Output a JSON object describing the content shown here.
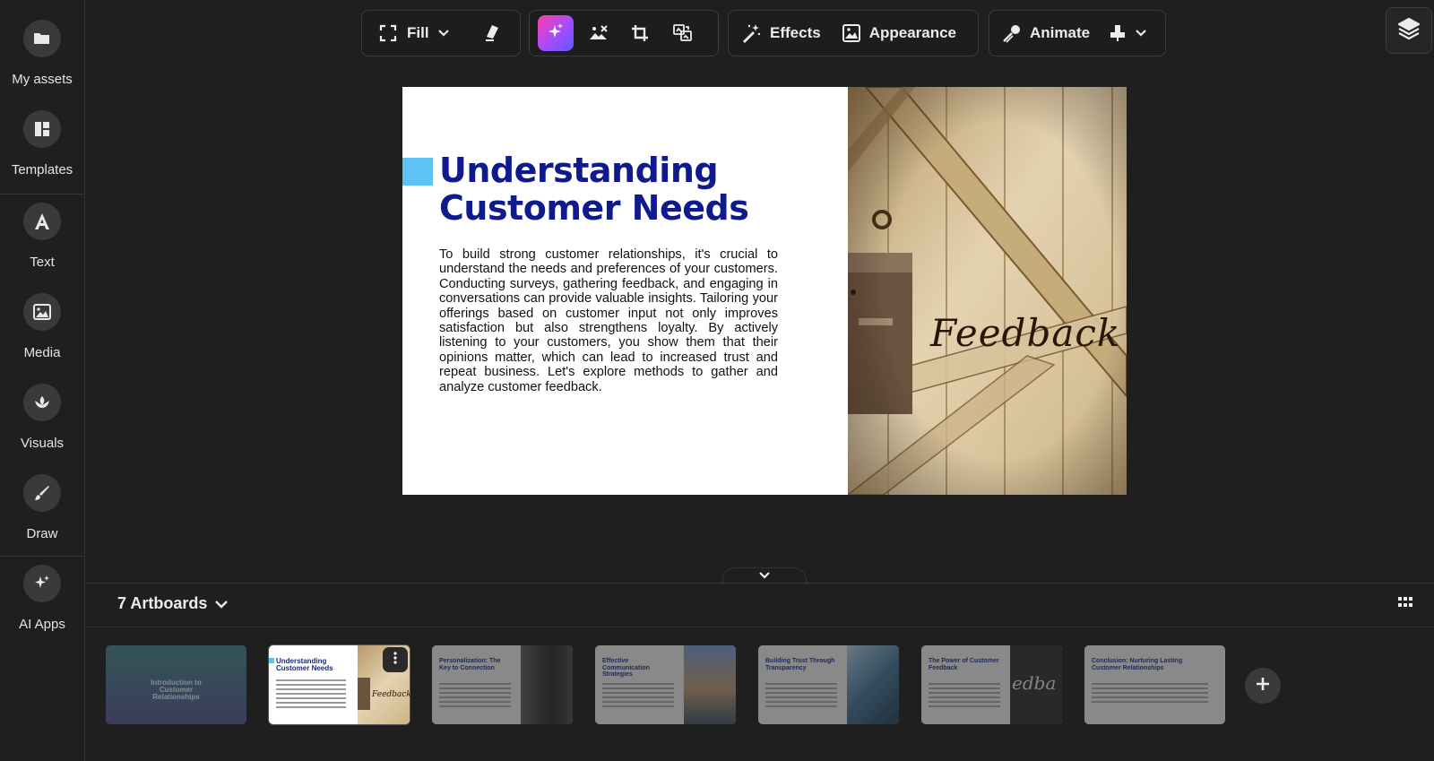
{
  "sidebar": {
    "items": [
      {
        "label": "My assets",
        "icon": "folder-icon"
      },
      {
        "label": "Templates",
        "icon": "templates-icon"
      },
      {
        "label": "Text",
        "icon": "text-icon"
      },
      {
        "label": "Media",
        "icon": "image-icon"
      },
      {
        "label": "Visuals",
        "icon": "visuals-icon"
      },
      {
        "label": "Draw",
        "icon": "brush-icon"
      },
      {
        "label": "AI Apps",
        "icon": "sparkle-icon"
      }
    ]
  },
  "toolbar": {
    "fill_label": "Fill",
    "effects_label": "Effects",
    "appearance_label": "Appearance",
    "animate_label": "Animate"
  },
  "slide": {
    "title": "Understanding Customer Needs",
    "body": "To build strong customer relationships, it's crucial to understand the needs and preferences of your customers. Conducting surveys, gathering feedback, and engaging in conversations can provide valuable insights. Tailoring your offerings based on customer input not only improves satisfaction but also strengthens loyalty. By actively listening to your customers, you show them that their opinions matter, which can lead to increased trust and repeat business. Let's explore methods to gather and analyze customer feedback.",
    "image_text": "Feedback"
  },
  "artboards": {
    "header": "7 Artboards",
    "thumbnails": [
      {
        "title": "Introduction to Customer Relationships"
      },
      {
        "title": "Understanding Customer Needs",
        "image_text": "Feedback"
      },
      {
        "title": "Personalization: The Key to Connection"
      },
      {
        "title": "Effective Communication Strategies"
      },
      {
        "title": "Building Trust Through Transparency"
      },
      {
        "title": "The Power of Customer Feedback",
        "image_text": "edba"
      },
      {
        "title": "Conclusion: Nurturing Lasting Customer Relationships"
      }
    ]
  },
  "colors": {
    "title_blue": "#0f1a8c",
    "accent_blue": "#5ec3f2",
    "magic_gradient_start": "#ff3fa6",
    "magic_gradient_end": "#5b5bff"
  }
}
